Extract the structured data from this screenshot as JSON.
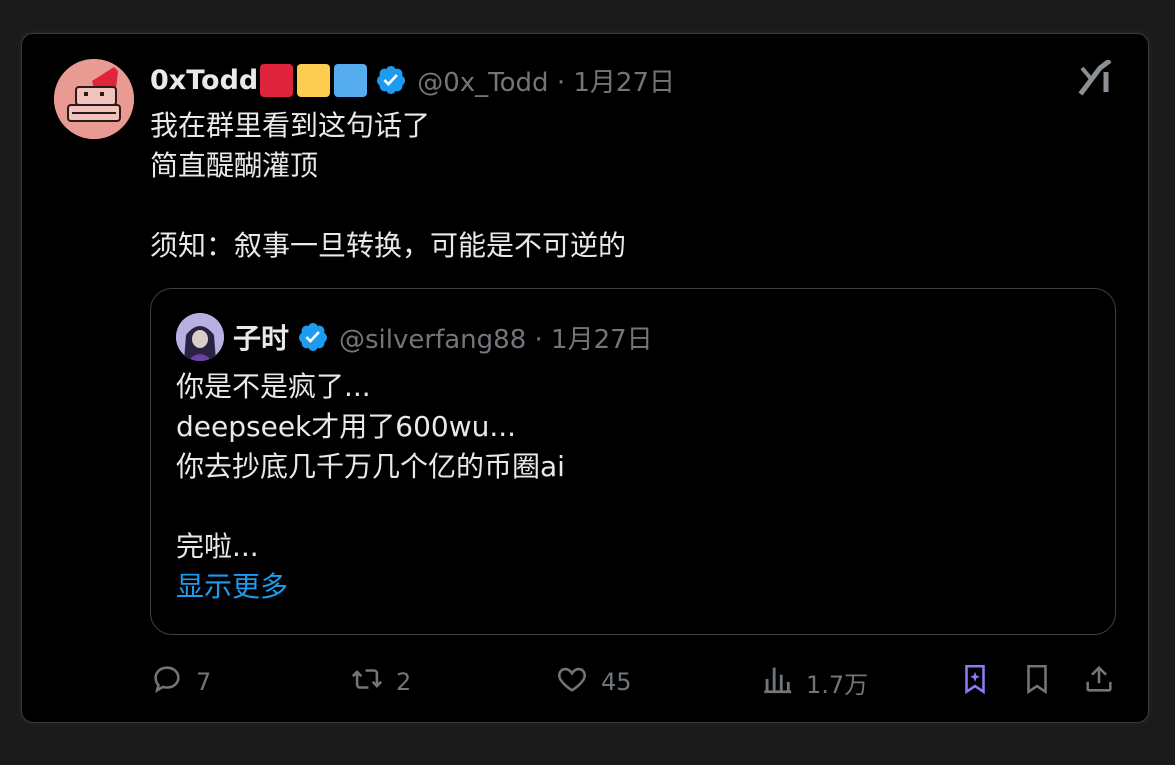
{
  "tweet": {
    "author_name": "0xTodd",
    "handle": "@0x_Todd",
    "date": "1月27日",
    "badge_colors": [
      "#e0243b",
      "#fccd50",
      "#55acee"
    ],
    "text_lines": [
      "我在群里看到这句话了",
      "简直醍醐灌顶",
      "",
      "须知：叙事一旦转换，可能是不可逆的"
    ]
  },
  "quote": {
    "author_name": "子时",
    "handle": "@silverfang88",
    "date": "1月27日",
    "text_lines": [
      "你是不是疯了...",
      "deepseek才用了600wu...",
      "你去抄底几千万几个亿的币圈ai",
      "",
      "完啦..."
    ],
    "show_more": "显示更多"
  },
  "actions": {
    "replies": "7",
    "reposts": "2",
    "likes": "45",
    "views": "1.7万"
  },
  "icons": {
    "verified": "verified-badge-icon",
    "grok": "grok-icon",
    "reply": "reply-icon",
    "repost": "repost-icon",
    "like": "heart-icon",
    "views": "views-icon",
    "grok_bookmark": "grok-bookmark-icon",
    "bookmark": "bookmark-icon",
    "share": "share-icon"
  },
  "colors": {
    "accent": "#1d9bf0",
    "muted": "#71767b",
    "text": "#e7e9ea",
    "grok_purple": "#8b7cf6"
  }
}
